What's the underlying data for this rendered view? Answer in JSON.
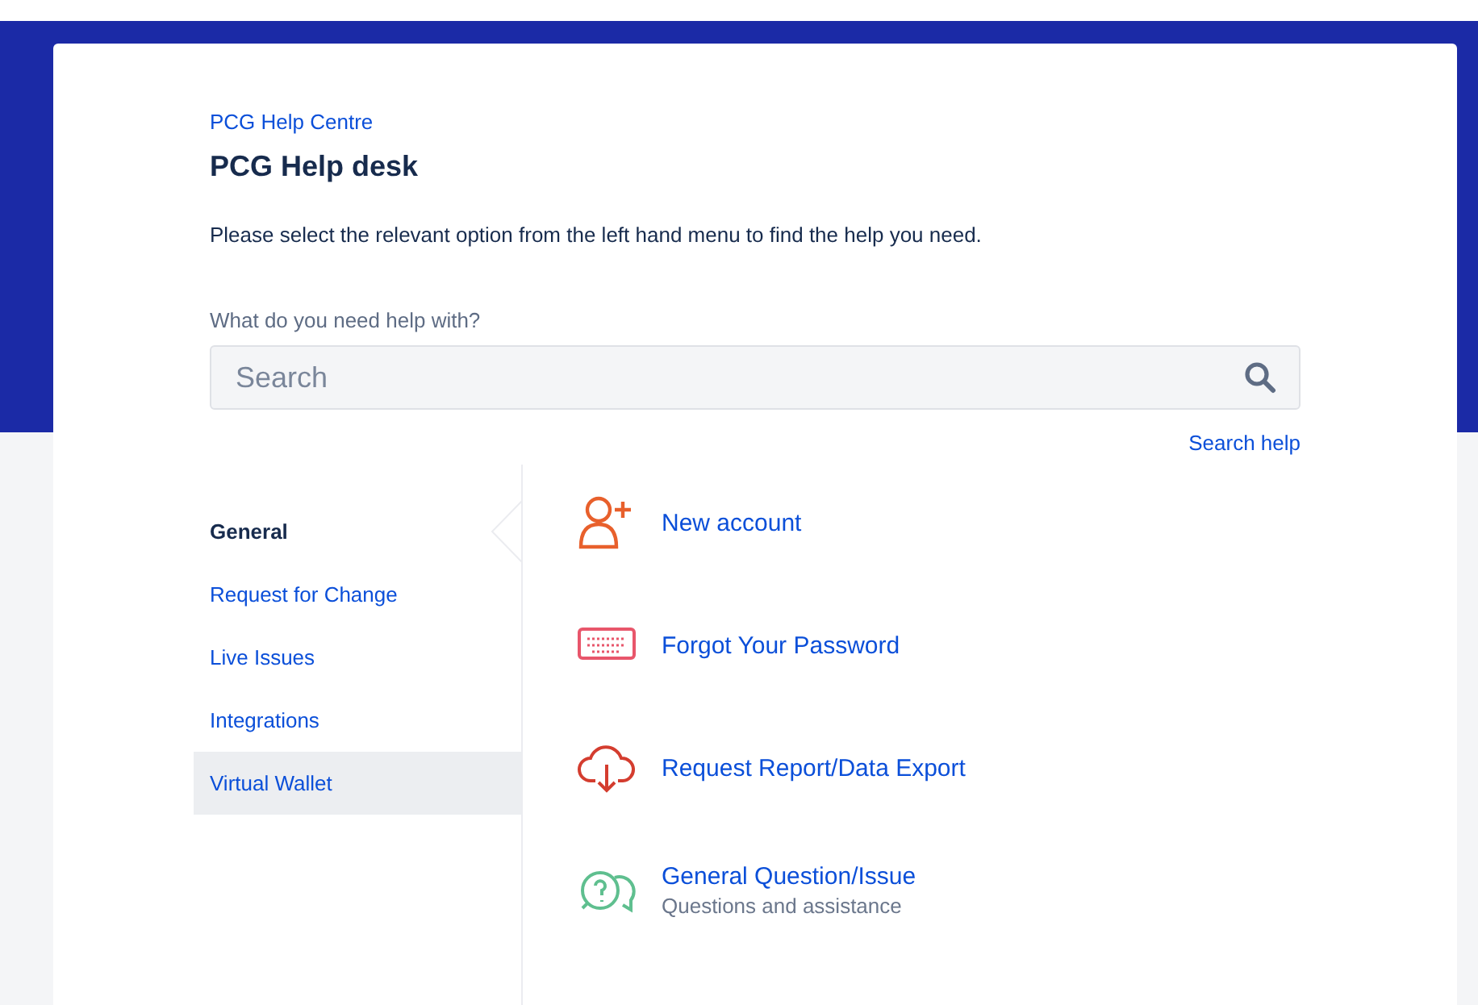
{
  "breadcrumb": "PCG Help Centre",
  "title": "PCG Help desk",
  "description": "Please select the relevant option from the left hand menu to find the help you need.",
  "search": {
    "label": "What do you need help with?",
    "placeholder": "Search",
    "help_link": "Search help"
  },
  "groups": [
    {
      "label": "General",
      "selected": true,
      "highlighted": false
    },
    {
      "label": "Request for Change",
      "selected": false,
      "highlighted": false
    },
    {
      "label": "Live Issues",
      "selected": false,
      "highlighted": false
    },
    {
      "label": "Integrations",
      "selected": false,
      "highlighted": false
    },
    {
      "label": "Virtual Wallet",
      "selected": false,
      "highlighted": true
    }
  ],
  "request_types": [
    {
      "kind": "person-add",
      "name": "New account"
    },
    {
      "kind": "keyboard",
      "name": "Forgot Your Password"
    },
    {
      "kind": "cloud-download",
      "name": "Request Report/Data Export"
    },
    {
      "kind": "chat-question",
      "name": "General Question/Issue",
      "description": "Questions and assistance"
    }
  ]
}
